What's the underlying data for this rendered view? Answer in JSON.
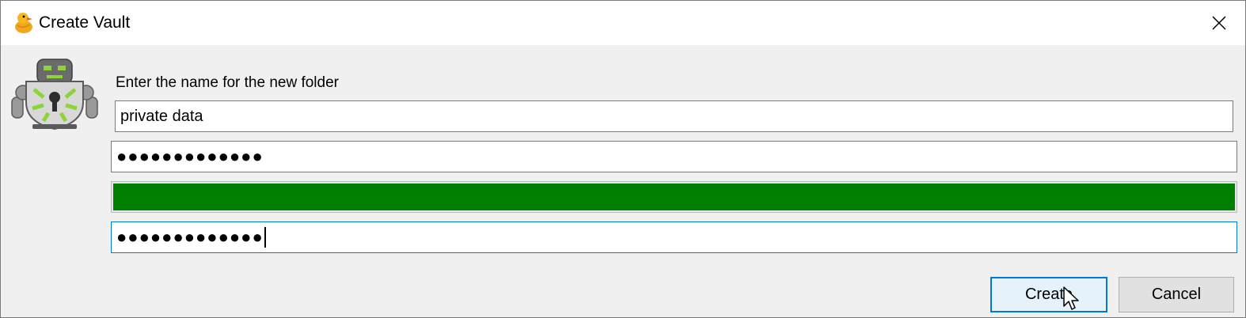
{
  "window": {
    "title": "Create Vault",
    "icon": "duck-icon",
    "close_icon": "close-icon"
  },
  "dialog": {
    "mascot_icon": "robot-lock-icon",
    "prompt": "Enter the name for the new folder",
    "folder_name": "private data",
    "password_masked": "●●●●●●●●●●●●●",
    "confirm_password_masked": "●●●●●●●●●●●●●",
    "strength_level": 1.0,
    "strength_color": "#008000"
  },
  "buttons": {
    "create": "Create",
    "cancel": "Cancel"
  },
  "colors": {
    "focus_border": "#0078d7",
    "dialog_background": "#f0f0f0"
  }
}
